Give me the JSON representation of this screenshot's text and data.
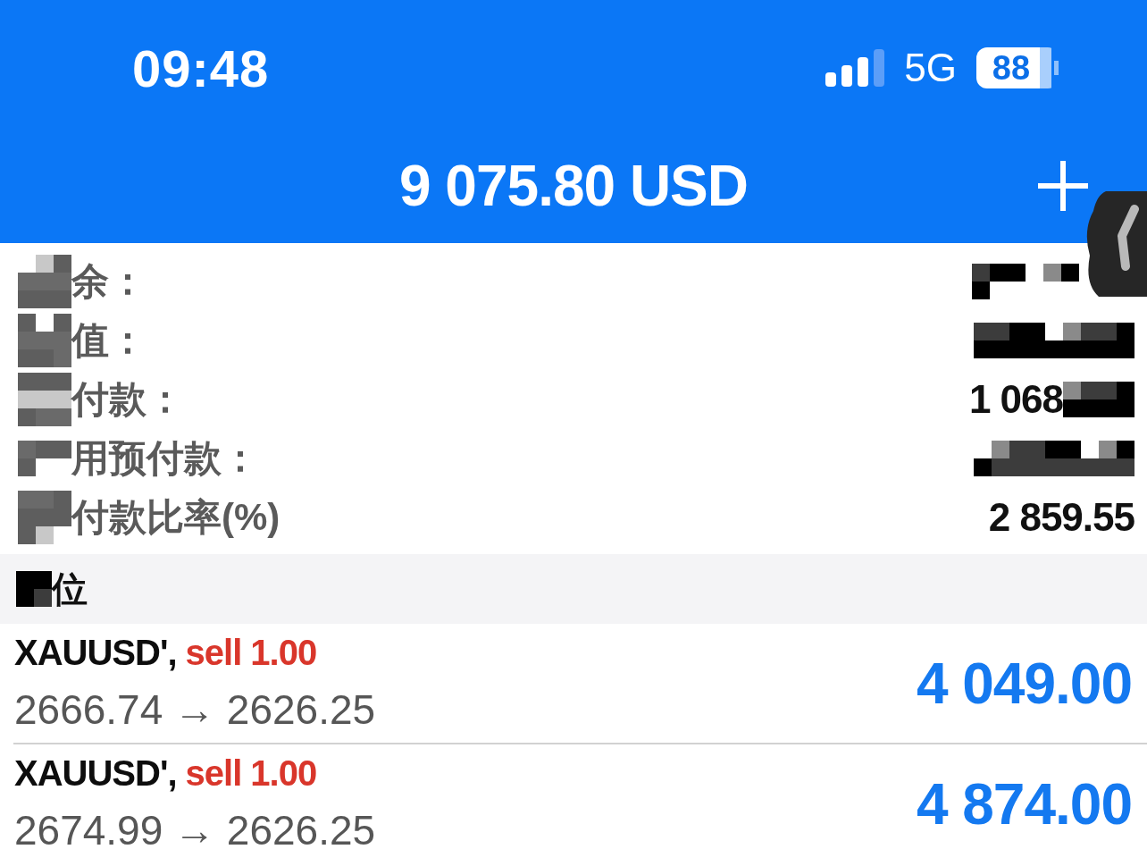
{
  "status_bar": {
    "time": "09:48",
    "network": "5G",
    "battery": "88"
  },
  "header": {
    "title": "9 075.80 USD"
  },
  "account": [
    {
      "label": "余：",
      "label_redacted": true,
      "value_redacted": true
    },
    {
      "label": "值：",
      "label_redacted": true,
      "value_redacted": true
    },
    {
      "label": "付款：",
      "label_redacted": true,
      "value": "1 068",
      "value_redacted": true
    },
    {
      "label": "用预付款：",
      "label_redacted": true,
      "value_redacted": true
    },
    {
      "label": "付款比率(%)",
      "label_redacted": true,
      "value": "2 859.55",
      "value_redacted": false
    }
  ],
  "positions_section": {
    "title": "位",
    "title_redacted": true
  },
  "positions": [
    {
      "symbol": "XAUUSD',",
      "order": "sell 1.00",
      "prices": "2666.74 → 2626.25",
      "profit": "4 049.00"
    },
    {
      "symbol": "XAUUSD',",
      "order": "sell 1.00",
      "prices": "2674.99 → 2626.25",
      "profit": "4 874.00"
    }
  ]
}
